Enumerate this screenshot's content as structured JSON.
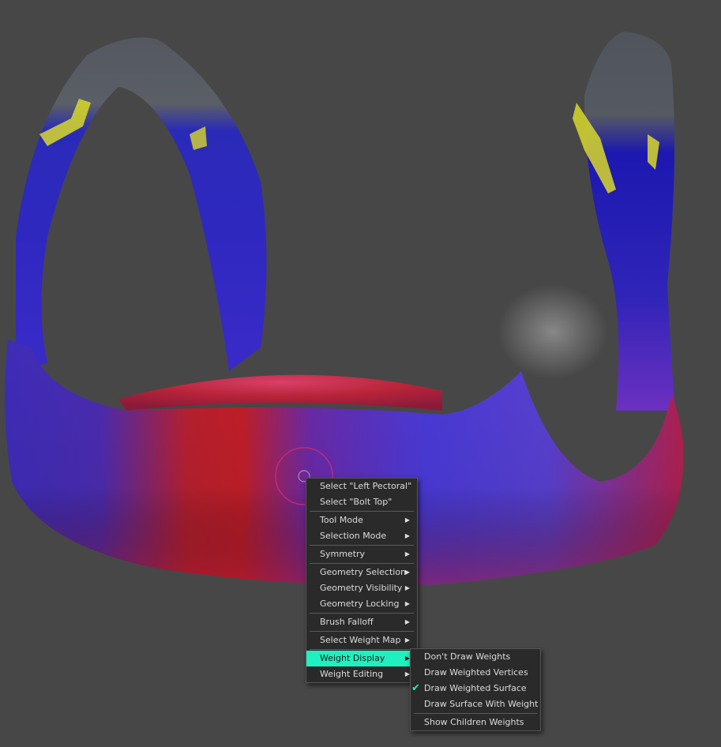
{
  "context_menu": {
    "items": [
      {
        "label": "Select \"Left Pectoral\"",
        "submenu": false
      },
      {
        "label": "Select \"Bolt Top\"",
        "submenu": false
      },
      {
        "separator": true
      },
      {
        "label": "Tool Mode",
        "submenu": true
      },
      {
        "label": "Selection Mode",
        "submenu": true
      },
      {
        "separator": true
      },
      {
        "label": "Symmetry",
        "submenu": true
      },
      {
        "separator": true
      },
      {
        "label": "Geometry Selection",
        "submenu": true
      },
      {
        "label": "Geometry Visibility",
        "submenu": true
      },
      {
        "label": "Geometry Locking",
        "submenu": true
      },
      {
        "separator": true
      },
      {
        "label": "Brush Falloff",
        "submenu": true
      },
      {
        "separator": true
      },
      {
        "label": "Select Weight Map",
        "submenu": true
      },
      {
        "separator": true
      },
      {
        "label": "Weight Display",
        "submenu": true,
        "highlighted": true
      },
      {
        "label": "Weight Editing",
        "submenu": true
      }
    ]
  },
  "weight_display_submenu": {
    "items": [
      {
        "label": "Don't Draw Weights",
        "checked": false
      },
      {
        "label": "Draw Weighted Vertices",
        "checked": false
      },
      {
        "label": "Draw Weighted Surface",
        "checked": true
      },
      {
        "label": "Draw Surface With Weight",
        "checked": false
      },
      {
        "separator": true
      },
      {
        "label": "Show Children Weights",
        "checked": false
      }
    ]
  },
  "icons": {
    "submenu_arrow": "▶",
    "check": "✔"
  },
  "colors": {
    "viewport_bg": "#474747",
    "menu_bg": "#2a2a2a",
    "highlight": "#1ff0c0",
    "text": "#dcdcdc"
  }
}
